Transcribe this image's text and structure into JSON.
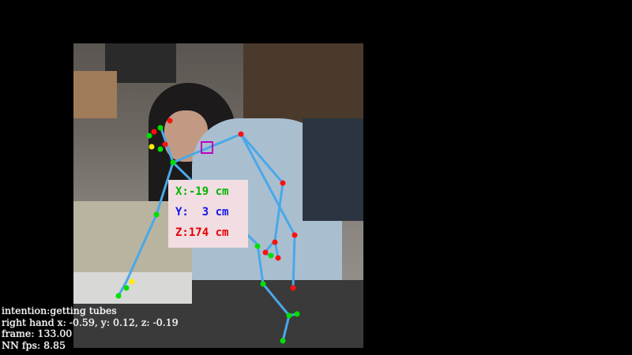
{
  "coordinates": {
    "x_label": "X:-19 cm",
    "y_label": "Y:  3 cm",
    "z_label": "Z:174 cm",
    "x_color": "#00b400",
    "y_color": "#1414e6",
    "z_color": "#e60000"
  },
  "status": {
    "intention": "intention:getting tubes",
    "right_hand": "right hand x: -0.59, y: 0.12, z: -0.19",
    "frame": "frame: 133.00",
    "fps": "NN fps: 8.85"
  },
  "colors": {
    "skeleton_line": "#4aa8e8",
    "keypoint_green": "#00e000",
    "keypoint_red": "#ff1010",
    "keypoint_yellow": "#ffee00",
    "neck_marker": "#c000c0",
    "coord_box_bg": "#f1dde2"
  },
  "icons": {
    "neck_marker": "square-outline-marker",
    "keypoints": "dot-marker"
  }
}
